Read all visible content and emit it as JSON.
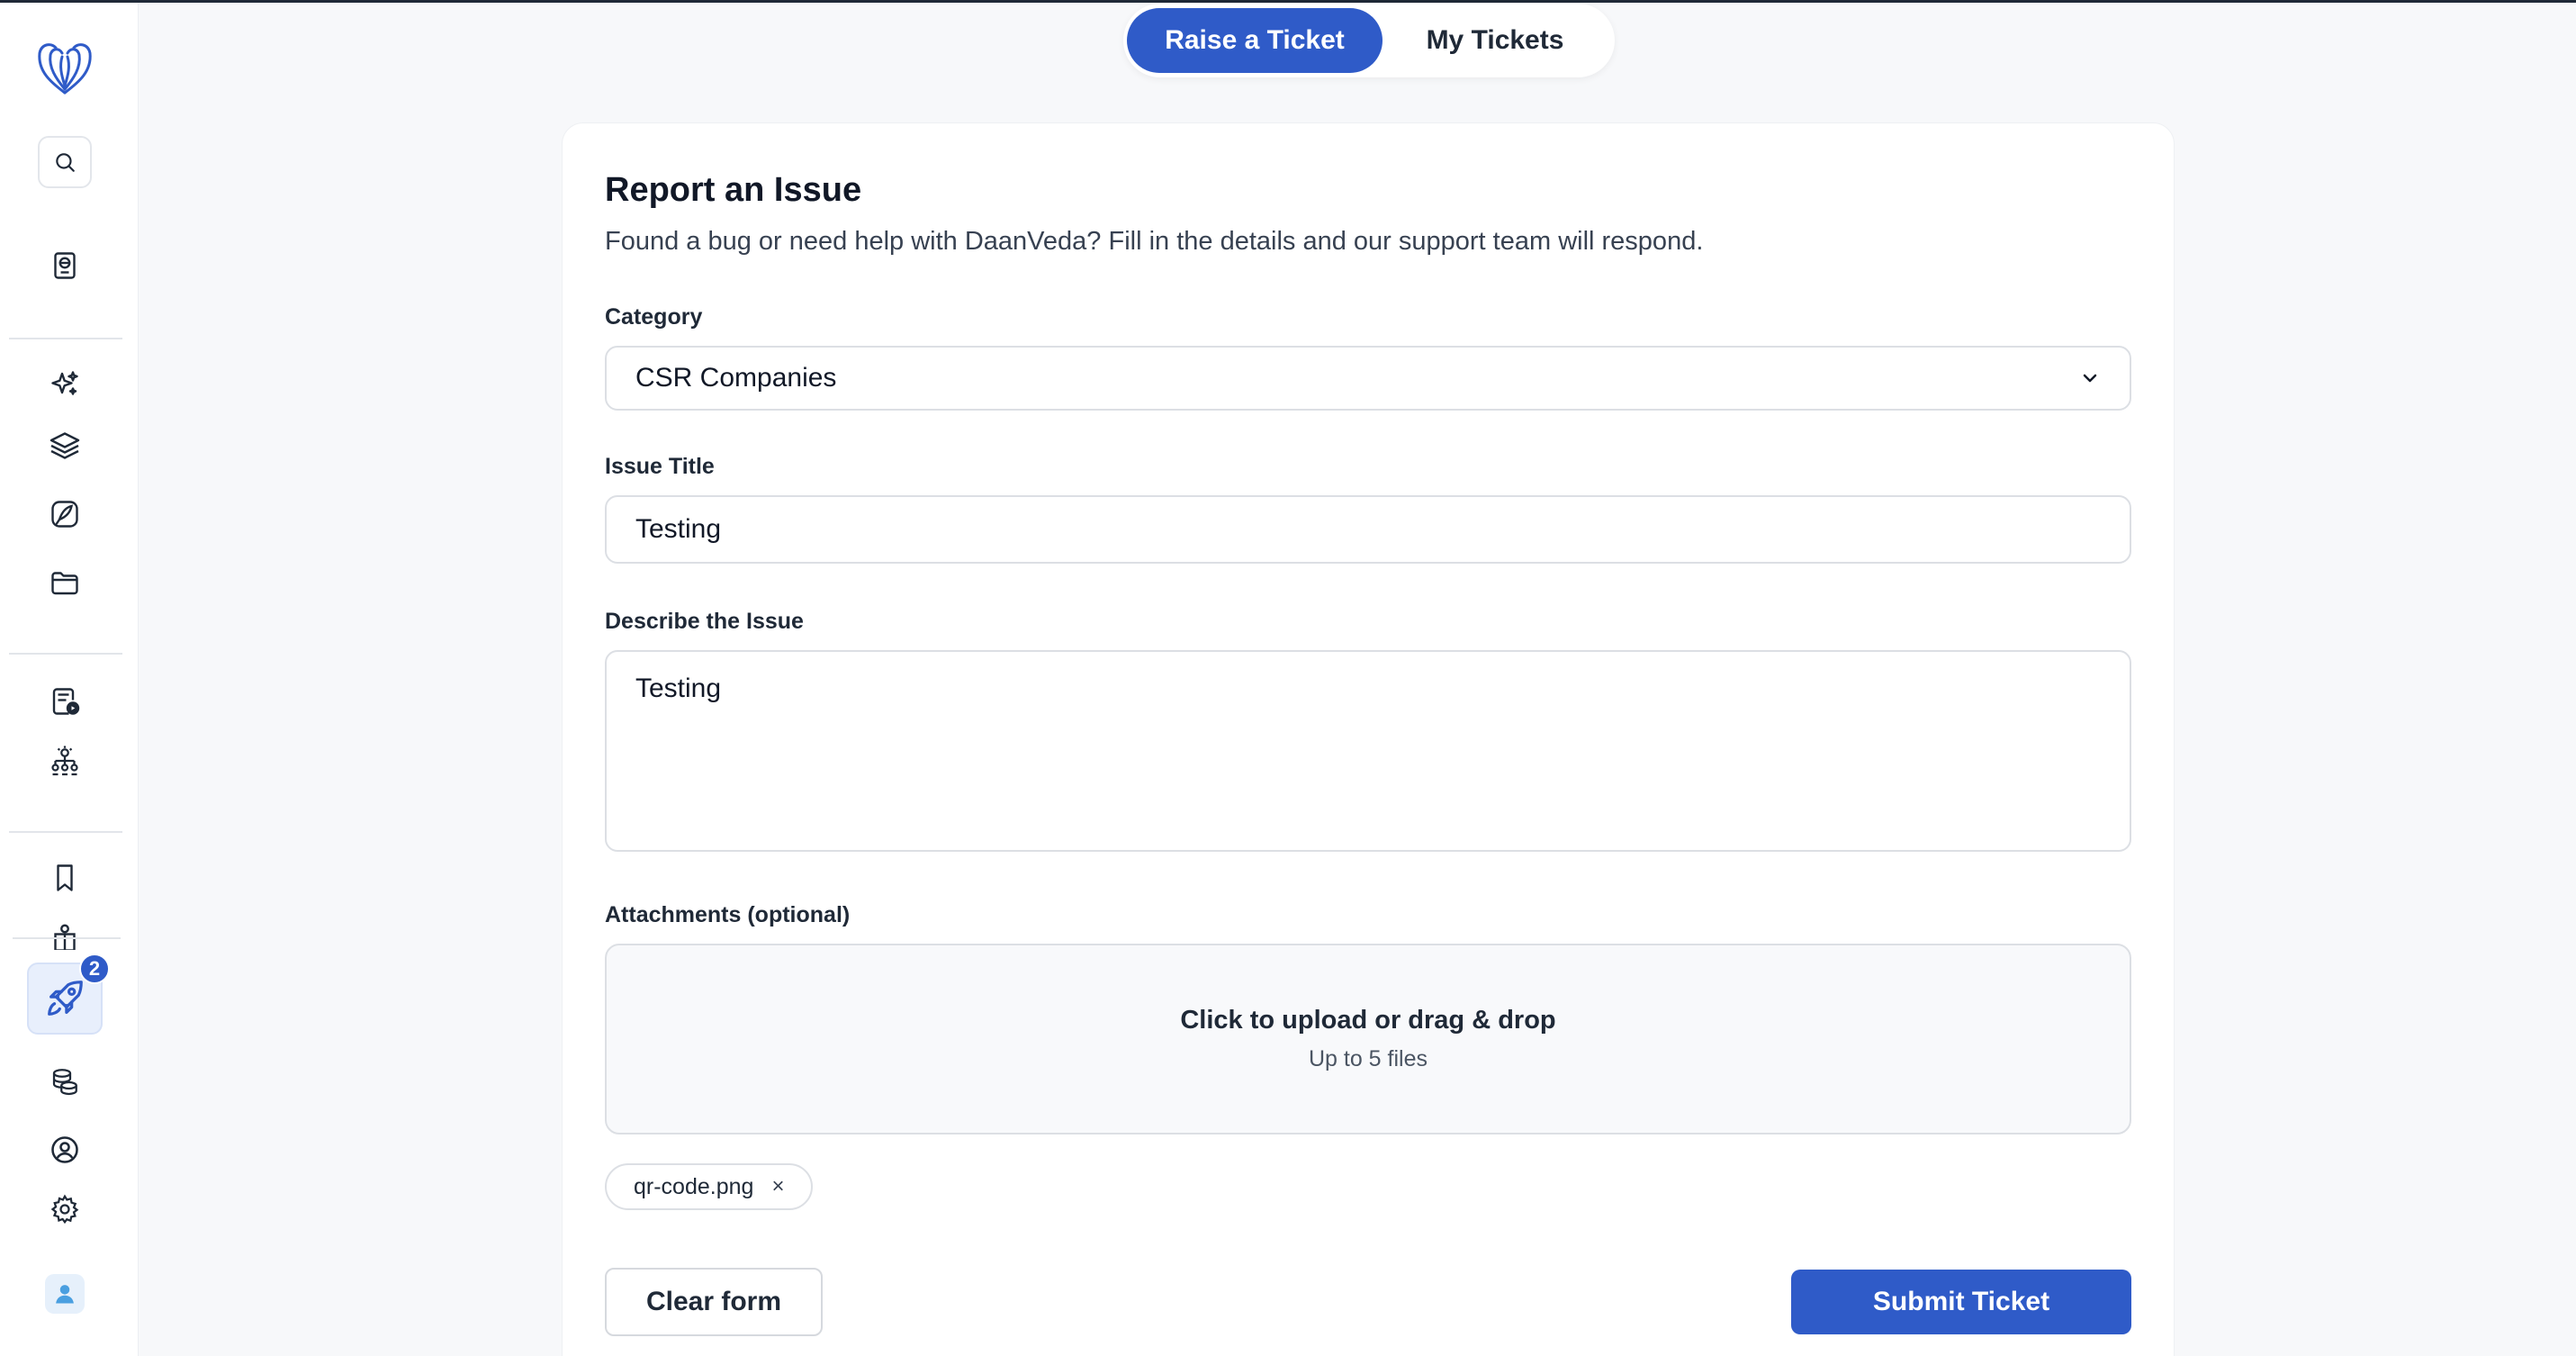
{
  "colors": {
    "accent": "#2f5bc8",
    "accent_light": "#e8effc",
    "border": "#dcdfe4"
  },
  "tabs": [
    {
      "label": "Raise a Ticket",
      "active": true
    },
    {
      "label": "My Tickets",
      "active": false
    }
  ],
  "sidebar": {
    "icons": [
      "logo-icon",
      "search-icon",
      "passport-icon",
      "sparkles-icon",
      "layers-icon",
      "feather-icon",
      "folder-icon",
      "document-play-icon",
      "network-icon",
      "bookmark-icon",
      "gift-icon",
      "rocket-icon",
      "coins-icon",
      "user-circle-icon",
      "gear-icon",
      "avatar-icon"
    ],
    "badge_count": "2"
  },
  "form": {
    "title": "Report an Issue",
    "subtitle": "Found a bug or need help with DaanVeda? Fill in the details and our support team will respond.",
    "category": {
      "label": "Category",
      "value": "CSR Companies"
    },
    "issue_title": {
      "label": "Issue Title",
      "value": "Testing"
    },
    "description": {
      "label": "Describe the Issue",
      "value": "Testing"
    },
    "attachments": {
      "label": "Attachments (optional)",
      "upload_title": "Click to upload or drag & drop",
      "upload_sub": "Up to 5 files",
      "files": [
        "qr-code.png"
      ],
      "remove_glyph": "×"
    },
    "clear_label": "Clear form",
    "submit_label": "Submit Ticket"
  }
}
